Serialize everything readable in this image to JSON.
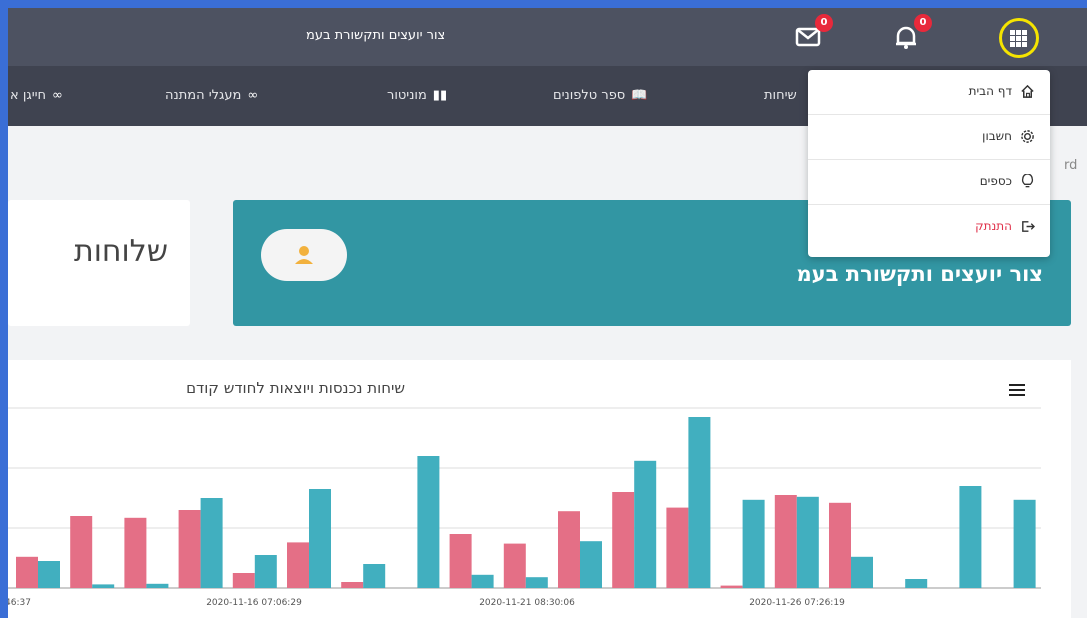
{
  "header": {
    "title": "צור יועצים ותקשורת בעמ",
    "mail_badge": "0",
    "bell_badge": "0"
  },
  "nav": {
    "items": [
      {
        "label": "שיחות",
        "icon": "calls-icon"
      },
      {
        "label": "ספר טלפונים",
        "icon": "book-icon"
      },
      {
        "label": "מוניטור",
        "icon": "bar-chart-icon"
      },
      {
        "label": "מעגלי המתנה",
        "icon": "link-icon"
      },
      {
        "label": "חייגן א",
        "icon": "link-icon"
      }
    ]
  },
  "breadcrumb_tail": "rd",
  "dropdown": {
    "items": [
      {
        "label": "דף הבית",
        "icon": "home-icon"
      },
      {
        "label": "חשבון",
        "icon": "gear-icon"
      },
      {
        "label": "כספים",
        "icon": "lightbulb-icon"
      },
      {
        "label": "התנתק",
        "icon": "logout-icon"
      }
    ]
  },
  "cards": {
    "branches_label": "שלוחות",
    "company_name": "צור יועצים ותקשורת בעמ"
  },
  "colors": {
    "topbar": "#4d5261",
    "navbar": "#3f4350",
    "teal": "#3296a3",
    "pink": "#e46f86",
    "cyan": "#41afbf",
    "accent_ring": "#f5e400",
    "badge": "#e8293b",
    "logout": "#e0314a"
  },
  "chart_data": {
    "type": "bar",
    "title": "שיחות נכנסות ויוצאות לחודש קודם",
    "x_tick_labels": [
      "46:37",
      "2020-11-16 07:06:29",
      "2020-11-21 08:30:06",
      "2020-11-26 07:26:19"
    ],
    "ylim": [
      0,
      3
    ],
    "grid": true,
    "series": [
      {
        "color": "#e46f86",
        "values": [
          0.52,
          1.2,
          1.17,
          1.3,
          0.25,
          0.76,
          0.1,
          0,
          0.9,
          0.74,
          1.28,
          1.6,
          1.34,
          0.04,
          1.55,
          1.42,
          0,
          0,
          0
        ]
      },
      {
        "color": "#41afbf",
        "values": [
          0.45,
          0.06,
          0.07,
          1.5,
          0.55,
          1.65,
          0.4,
          2.2,
          0.22,
          0.18,
          0.78,
          2.12,
          2.85,
          1.47,
          1.52,
          0.52,
          0.15,
          1.7,
          1.47
        ]
      }
    ]
  }
}
